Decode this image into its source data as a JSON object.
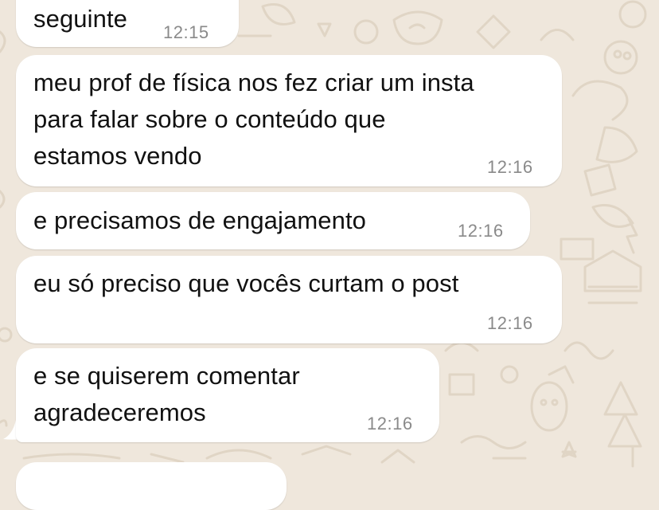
{
  "chat": {
    "messages": [
      {
        "lines": [
          "seguinte"
        ],
        "time": "12:15"
      },
      {
        "lines": [
          "meu prof de física nos fez criar um insta",
          "para falar sobre o conteúdo que",
          "estamos vendo"
        ],
        "time": "12:16"
      },
      {
        "lines": [
          "e precisamos de engajamento"
        ],
        "time": "12:16"
      },
      {
        "lines": [
          "eu só preciso que vocês curtam o post"
        ],
        "time": "12:16"
      },
      {
        "lines": [
          "e se quiserem comentar",
          "agradeceremos"
        ],
        "time": "12:16"
      }
    ]
  },
  "colors": {
    "wallpaper": "#efe7dc",
    "doodle": "#e2d8c9",
    "bubble": "#ffffff",
    "text": "#111111",
    "timestamp": "#8a8a8a"
  }
}
